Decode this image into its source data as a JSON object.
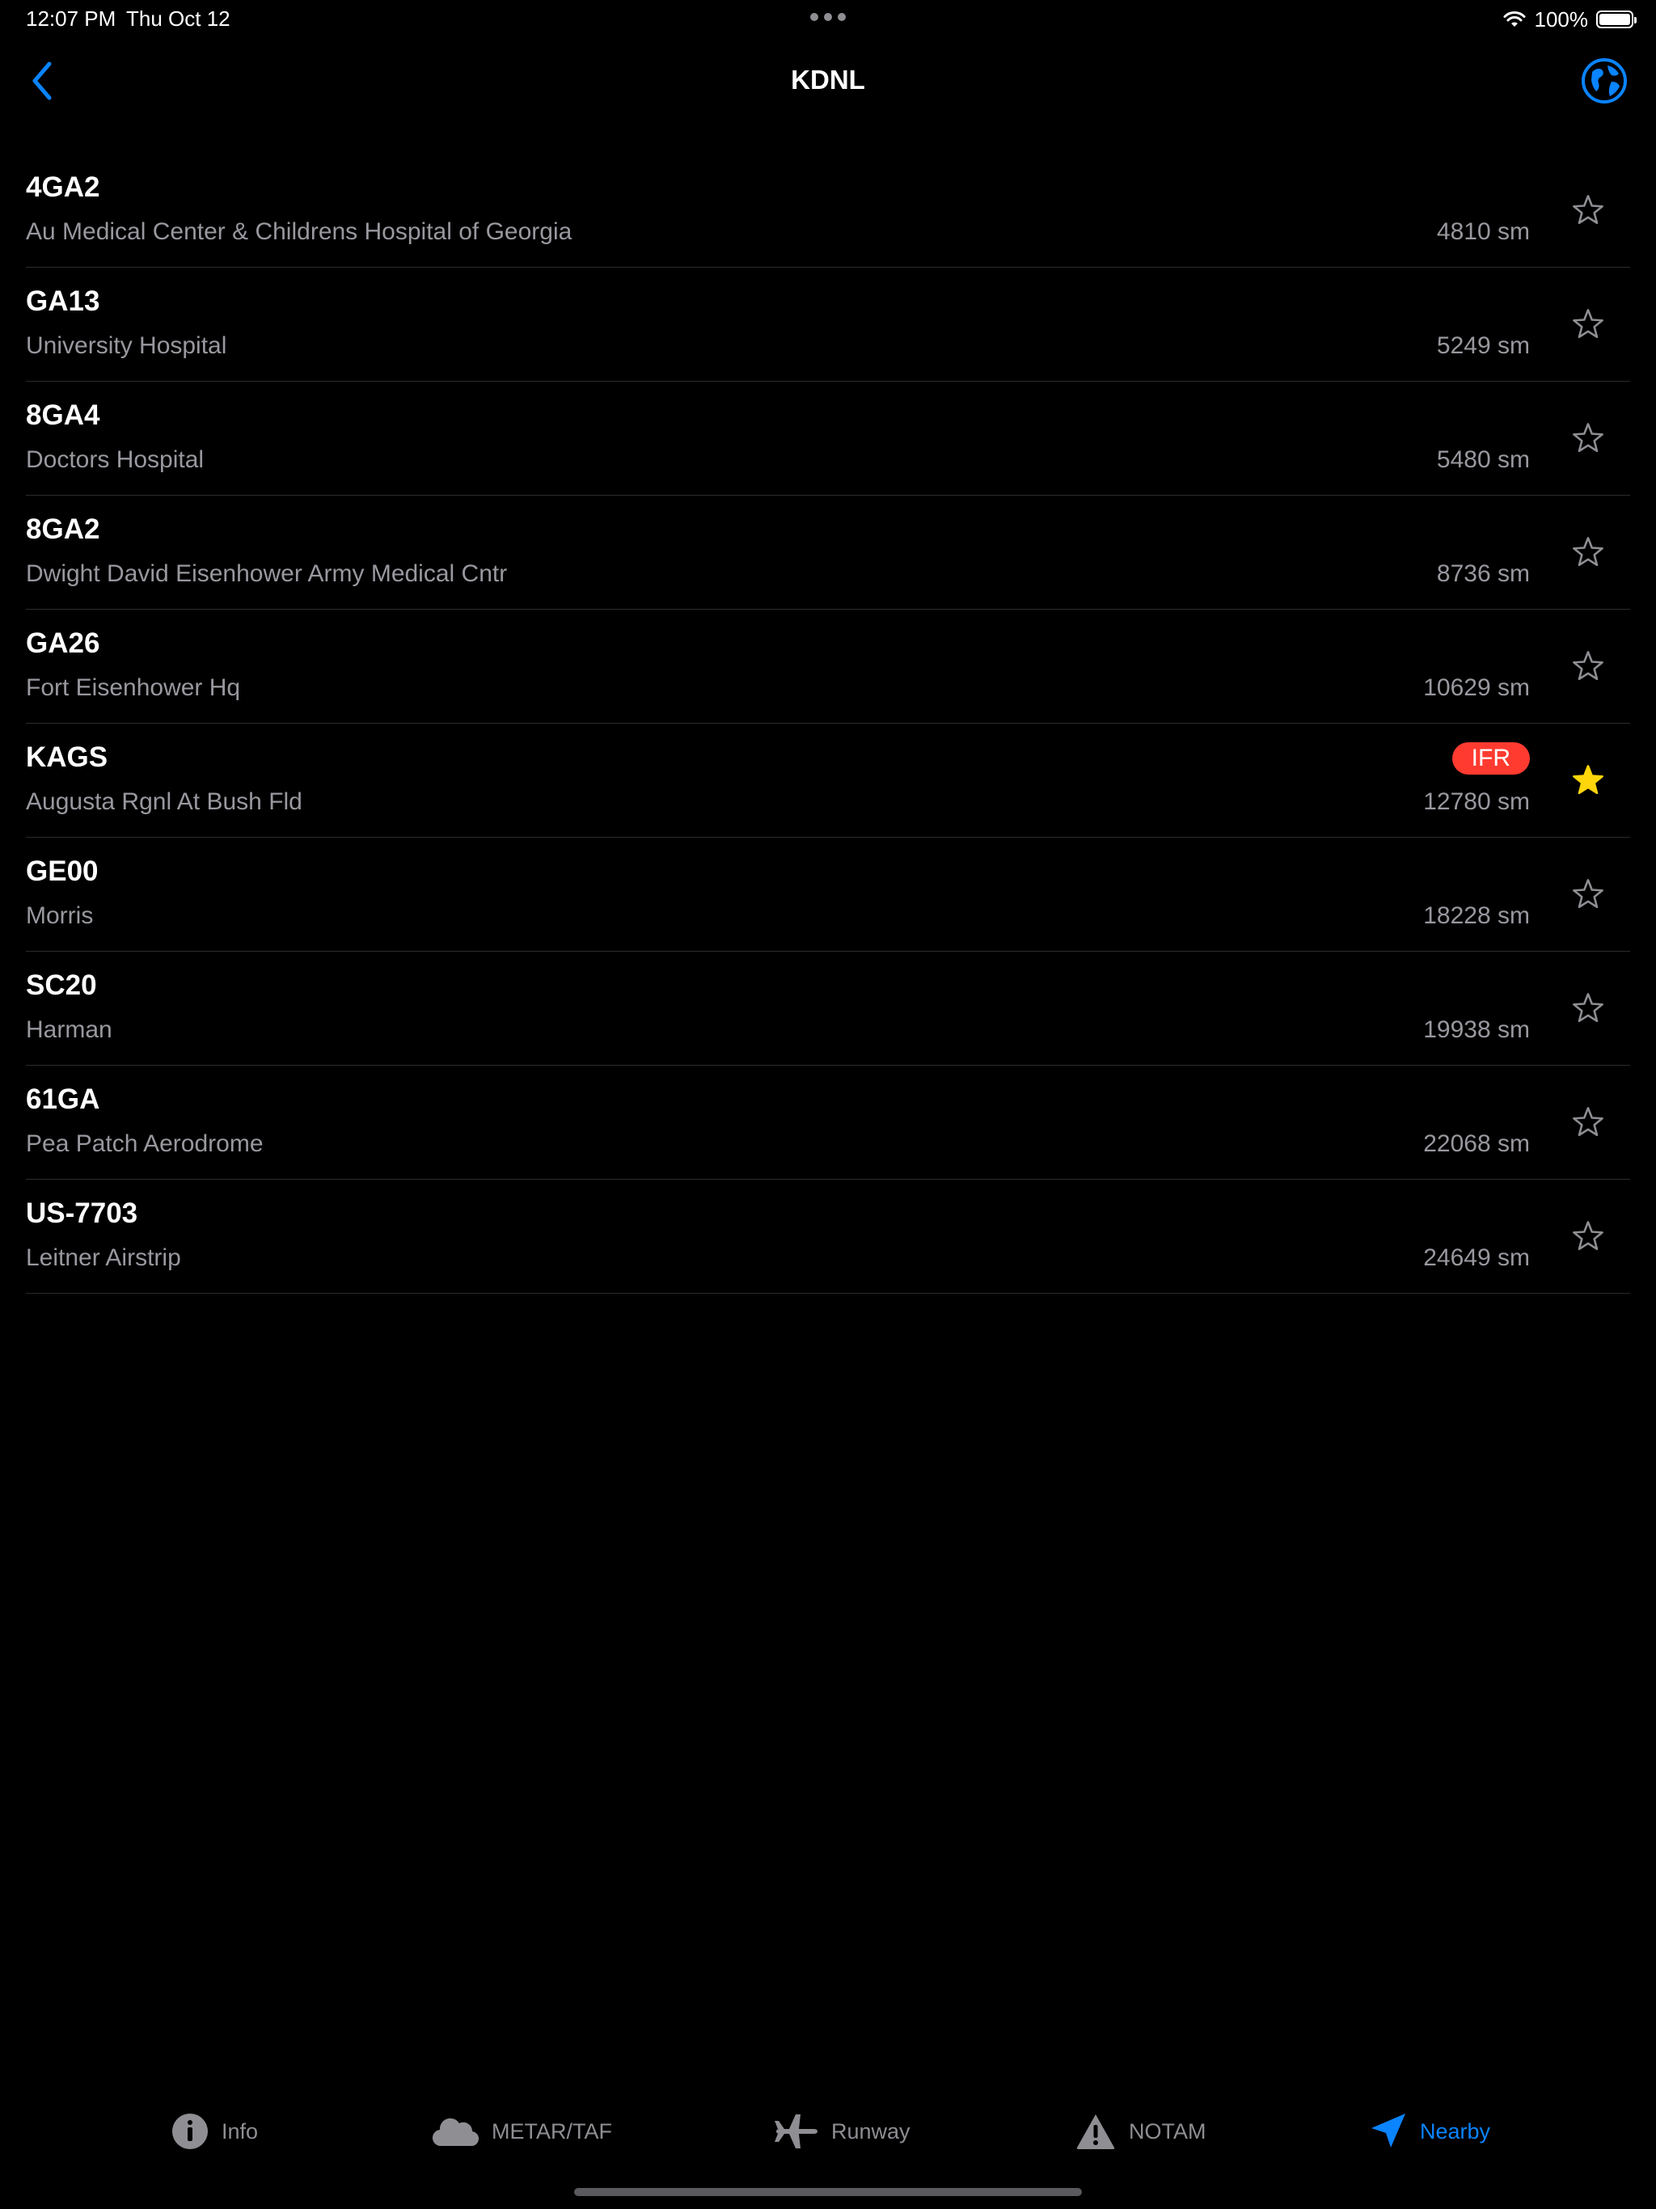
{
  "status_bar": {
    "time": "12:07 PM",
    "date": "Thu Oct 12",
    "battery": "100%"
  },
  "nav": {
    "title": "KDNL",
    "back_icon": "chevron-left-icon",
    "globe_icon": "globe-icon"
  },
  "colors": {
    "accent": "#0a84ff",
    "ifr_badge": "#ff3b30",
    "favorite_star": "#ffd60a",
    "secondary_text": "#98989f"
  },
  "airports": [
    {
      "ident": "4GA2",
      "name": "Au Medical Center & Childrens Hospital of Georgia",
      "distance": "4810 sm",
      "badge": "",
      "favorite": false
    },
    {
      "ident": "GA13",
      "name": "University Hospital",
      "distance": "5249 sm",
      "badge": "",
      "favorite": false
    },
    {
      "ident": "8GA4",
      "name": "Doctors Hospital",
      "distance": "5480 sm",
      "badge": "",
      "favorite": false
    },
    {
      "ident": "8GA2",
      "name": "Dwight David Eisenhower Army Medical Cntr",
      "distance": "8736 sm",
      "badge": "",
      "favorite": false
    },
    {
      "ident": "GA26",
      "name": "Fort Eisenhower Hq",
      "distance": "10629 sm",
      "badge": "",
      "favorite": false
    },
    {
      "ident": "KAGS",
      "name": "Augusta Rgnl At Bush Fld",
      "distance": "12780 sm",
      "badge": "IFR",
      "favorite": true
    },
    {
      "ident": "GE00",
      "name": "Morris",
      "distance": "18228 sm",
      "badge": "",
      "favorite": false
    },
    {
      "ident": "SC20",
      "name": "Harman",
      "distance": "19938 sm",
      "badge": "",
      "favorite": false
    },
    {
      "ident": "61GA",
      "name": "Pea Patch Aerodrome",
      "distance": "22068 sm",
      "badge": "",
      "favorite": false
    },
    {
      "ident": "US-7703",
      "name": "Leitner Airstrip",
      "distance": "24649 sm",
      "badge": "",
      "favorite": false
    }
  ],
  "tabs": [
    {
      "label": "Info",
      "icon": "info-icon",
      "active": false
    },
    {
      "label": "METAR/TAF",
      "icon": "cloud-icon",
      "active": false
    },
    {
      "label": "Runway",
      "icon": "airplane-icon",
      "active": false
    },
    {
      "label": "NOTAM",
      "icon": "warning-icon",
      "active": false
    },
    {
      "label": "Nearby",
      "icon": "location-arrow-icon",
      "active": true
    }
  ]
}
